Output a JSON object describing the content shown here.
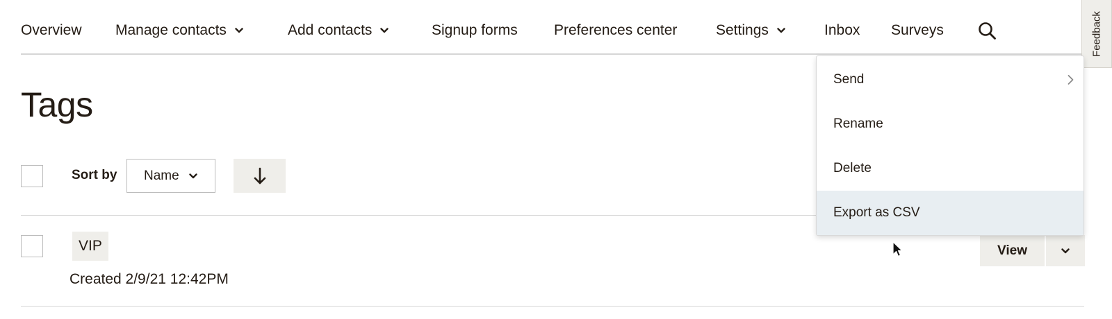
{
  "nav": {
    "items": [
      {
        "label": "Overview",
        "dropdown": false
      },
      {
        "label": "Manage contacts",
        "dropdown": true
      },
      {
        "label": "Add contacts",
        "dropdown": true
      },
      {
        "label": "Signup forms",
        "dropdown": false
      },
      {
        "label": "Preferences center",
        "dropdown": false
      },
      {
        "label": "Settings",
        "dropdown": true
      },
      {
        "label": "Inbox",
        "dropdown": false
      },
      {
        "label": "Surveys",
        "dropdown": false
      }
    ],
    "search_icon": "search-icon"
  },
  "feedback": {
    "label": "Feedback"
  },
  "page": {
    "title": "Tags"
  },
  "toolbar": {
    "sort_label": "Sort by",
    "sort_value": "Name",
    "sort_direction_icon": "arrow-down-icon"
  },
  "tags": [
    {
      "name": "VIP",
      "created": "Created 2/9/21 12:42PM",
      "view_label": "View"
    }
  ],
  "menu": {
    "items": [
      {
        "label": "Send",
        "submenu": true
      },
      {
        "label": "Rename",
        "submenu": false
      },
      {
        "label": "Delete",
        "submenu": false
      },
      {
        "label": "Export as CSV",
        "submenu": false,
        "highlighted": true
      }
    ]
  },
  "colors": {
    "text": "#241c15",
    "button_bg": "#efeeea",
    "menu_highlight": "#e8eef2",
    "border": "#d6d6d6"
  }
}
